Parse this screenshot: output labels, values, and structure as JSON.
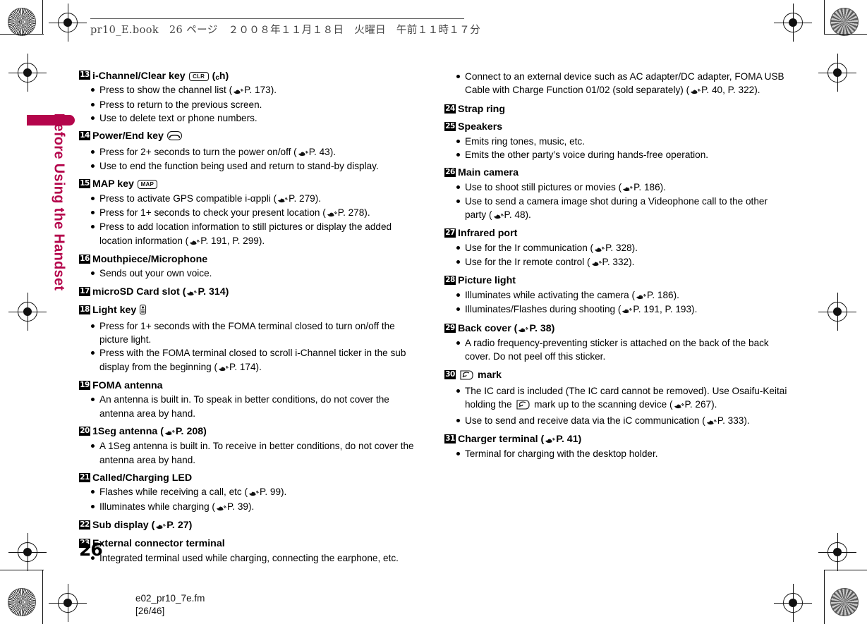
{
  "header": {
    "text": "pr10_E.book　26 ページ　２００８年１１月１８日　火曜日　午前１１時１７分"
  },
  "side_tab": {
    "label": "Before Using the Handset",
    "color": "#b4054b"
  },
  "footer": {
    "page_number": "26",
    "file_name": "e02_pr10_7e.fm",
    "page_of": "[26/46]"
  },
  "left_column": [
    {
      "number": "13",
      "title_before": "i-Channel/Clear key",
      "keycap": "CLR",
      "title_after": "(ch)",
      "bullets": [
        "Press to show the channel list (☞P. 173).",
        "Press to return to the previous screen.",
        "Use to delete text or phone numbers."
      ]
    },
    {
      "number": "14",
      "title_before": "Power/End key",
      "keycap": "end-call-icon",
      "title_after": "",
      "bullets": [
        "Press for 2+ seconds to turn the power on/off (☞P. 43).",
        "Use to end the function being used and return to stand-by display."
      ]
    },
    {
      "number": "15",
      "title_before": "MAP key",
      "keycap": "MAP",
      "title_after": "",
      "bullets": [
        "Press to activate GPS compatible i-αppli (☞P. 279).",
        "Press for 1+ seconds to check your present location (☞P. 278).",
        "Press to add location information to still pictures or display the added location information (☞P. 191, P. 299)."
      ]
    },
    {
      "number": "16",
      "title_before": "Mouthpiece/Microphone",
      "keycap": "",
      "title_after": "",
      "bullets": [
        "Sends out your own voice."
      ]
    },
    {
      "number": "17",
      "title_before": "microSD Card slot (☞P. 314)",
      "keycap": "",
      "title_after": "",
      "bullets": []
    },
    {
      "number": "18",
      "title_before": "Light key",
      "keycap": "light-icon",
      "title_after": "",
      "bullets": [
        "Press for 1+ seconds with the FOMA terminal closed to turn on/off the picture light.",
        "Press with the FOMA terminal closed to scroll i-Channel ticker in the sub display from the beginning (☞P. 174)."
      ]
    },
    {
      "number": "19",
      "title_before": "FOMA antenna",
      "keycap": "",
      "title_after": "",
      "bullets": [
        "An antenna is built in. To speak in better conditions, do not cover the antenna area by hand."
      ]
    },
    {
      "number": "20",
      "title_before": "1Seg antenna (☞P. 208)",
      "keycap": "",
      "title_after": "",
      "bullets": [
        "A 1Seg antenna is built in. To receive in better conditions, do not cover the antenna area by hand."
      ]
    },
    {
      "number": "21",
      "title_before": "Called/Charging LED",
      "keycap": "",
      "title_after": "",
      "bullets": [
        "Flashes while receiving a call, etc (☞P. 99).",
        "Illuminates while charging (☞P. 39)."
      ]
    },
    {
      "number": "22",
      "title_before": "Sub display (☞P. 27)",
      "keycap": "",
      "title_after": "",
      "bullets": []
    },
    {
      "number": "23",
      "title_before": "External connector terminal",
      "keycap": "",
      "title_after": "",
      "bullets": [
        "Integrated terminal used while charging, connecting the earphone, etc."
      ]
    }
  ],
  "right_column_lead_bullets": [
    "Connect to an external device such as AC adapter/DC adapter, FOMA USB Cable with Charge Function 01/02 (sold separately) (☞P. 40, P. 322)."
  ],
  "right_column": [
    {
      "number": "24",
      "title_before": "Strap ring",
      "keycap": "",
      "title_after": "",
      "bullets": []
    },
    {
      "number": "25",
      "title_before": "Speakers",
      "keycap": "",
      "title_after": "",
      "bullets": [
        "Emits ring tones, music, etc.",
        "Emits the other party’s voice during hands-free operation."
      ]
    },
    {
      "number": "26",
      "title_before": "Main camera",
      "keycap": "",
      "title_after": "",
      "bullets": [
        "Use to shoot still pictures or movies (☞P. 186).",
        "Use to send a camera image shot during a Videophone call to the other party (☞P. 48)."
      ]
    },
    {
      "number": "27",
      "title_before": "Infrared port",
      "keycap": "",
      "title_after": "",
      "bullets": [
        "Use for the Ir communication (☞P. 328).",
        "Use for the Ir remote control (☞P. 332)."
      ]
    },
    {
      "number": "28",
      "title_before": "Picture light",
      "keycap": "",
      "title_after": "",
      "bullets": [
        "Illuminates while activating the camera (☞P. 186).",
        "Illuminates/Flashes during shooting (☞P. 191, P. 193)."
      ]
    },
    {
      "number": "29",
      "title_before": "Back cover (☞P. 38)",
      "keycap": "",
      "title_after": "",
      "bullets": [
        "A radio frequency-preventing sticker is attached on the back of the back cover. Do not peel off this sticker."
      ]
    },
    {
      "number": "30",
      "title_before": "",
      "keycap": "ic-mark-icon",
      "title_after": "mark",
      "bullets": [
        "The IC card is included (The IC card cannot be removed). Use Osaifu-Keitai holding the ⟨iC⟩ mark up to the scanning device (☞P. 267).",
        "Use to send and receive data via the iC communication (☞P. 333)."
      ]
    },
    {
      "number": "31",
      "title_before": "Charger terminal (☞P. 41)",
      "keycap": "",
      "title_after": "",
      "bullets": [
        "Terminal for charging with the desktop holder."
      ]
    }
  ]
}
